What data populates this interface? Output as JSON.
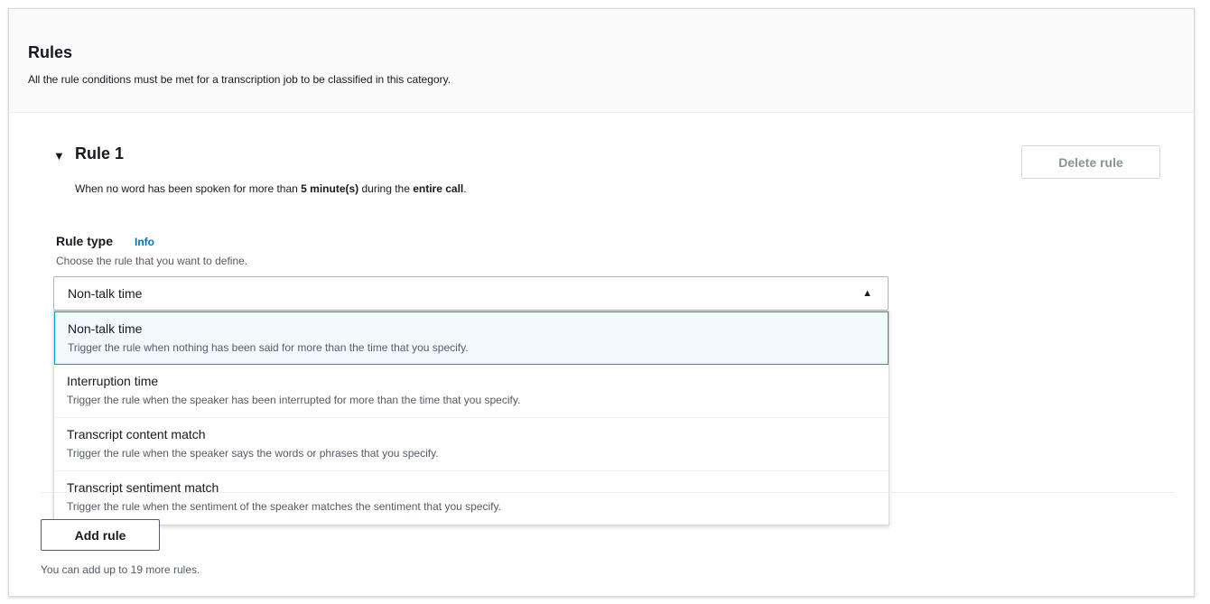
{
  "panel": {
    "title": "Rules",
    "description": "All the rule conditions must be met for a transcription job to be classified in this category."
  },
  "rule": {
    "toggle_icon": "caret-down-icon",
    "toggle_glyph": "▼",
    "title": "Rule 1",
    "summary_prefix": "When no word has been spoken for more than ",
    "summary_duration": "5 minute(s)",
    "summary_middle": " during the ",
    "summary_scope": "entire call",
    "summary_suffix": ".",
    "delete_label": "Delete rule"
  },
  "rule_type": {
    "label": "Rule type",
    "info_link": "Info",
    "description": "Choose the rule that you want to define.",
    "selected_value": "Non-talk time",
    "caret_icon": "caret-up-icon",
    "caret_glyph": "▲",
    "options": [
      {
        "label": "Non-talk time",
        "description": "Trigger the rule when nothing has been said for more than the time that you specify.",
        "selected": true
      },
      {
        "label": "Interruption time",
        "description": "Trigger the rule when the speaker has been interrupted for more than the time that you specify.",
        "selected": false
      },
      {
        "label": "Transcript content match",
        "description": "Trigger the rule when the speaker says the words or phrases that you specify.",
        "selected": false
      },
      {
        "label": "Transcript sentiment match",
        "description": "Trigger the rule when the sentiment of the speaker matches the sentiment that you specify.",
        "selected": false
      }
    ]
  },
  "footer": {
    "add_label": "Add rule",
    "note": "You can add up to 19 more rules."
  },
  "colors": {
    "link": "#0073bb",
    "selected_border": "#00a1c9",
    "selected_bg": "#f1faff"
  }
}
